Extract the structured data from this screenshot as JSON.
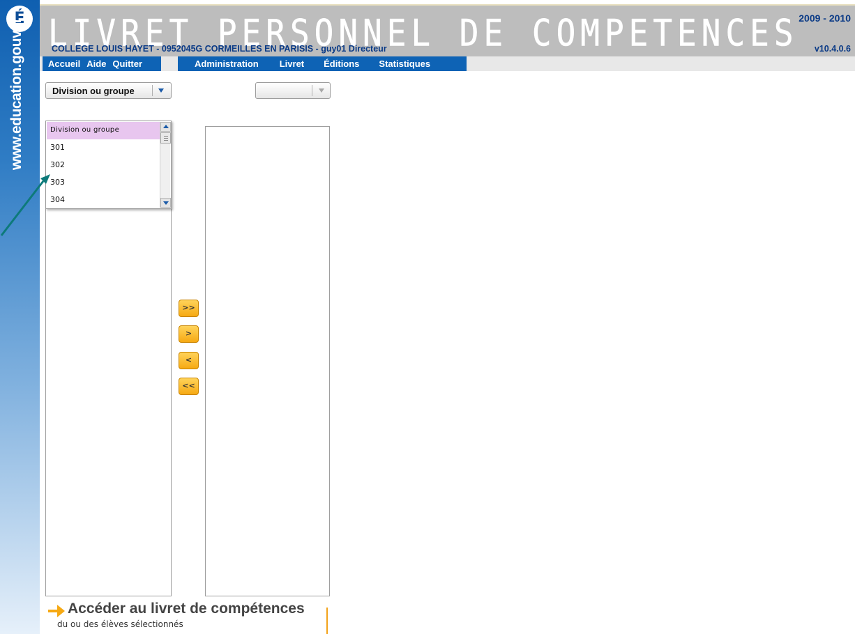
{
  "sidebar": {
    "logo_text": "É",
    "url": "www.education.gouv.fr"
  },
  "header": {
    "app_title": "LIVRET PERSONNEL DE COMPETENCES",
    "school_line": "COLLEGE LOUIS HAYET  - 0952045G CORMEILLES EN PARISIS - guy01 Directeur",
    "year": "2009 - 2010",
    "version": "v10.4.0.6"
  },
  "menu": {
    "left": [
      "Accueil",
      "Aide",
      "Quitter"
    ],
    "right": [
      "Administration",
      "Livret",
      "Éditions",
      "Statistiques"
    ]
  },
  "division_select": {
    "value": "Division ou groupe",
    "options": [
      "Division ou groupe",
      "301",
      "302",
      "303",
      "304"
    ],
    "selected_index": 0
  },
  "second_select": {
    "value": ""
  },
  "transfer_buttons": [
    ">>",
    ">",
    "<",
    "<<"
  ],
  "access_link": {
    "title": "Accéder au livret de compétences",
    "subtitle": "du ou des élèves sélectionnés"
  },
  "colors": {
    "menu_blue": "#0e63b5",
    "header_gray": "#bdbdbd",
    "text_navy": "#0a3a86",
    "button_orange": "#f6a913",
    "selected_option": "#e8c6ef",
    "annotation_arrow": "#0d7a7a"
  },
  "icons": {
    "logo": "marianne-e-logo-icon",
    "dropdown_arrow": "chevron-down-icon",
    "access_arrow": "arrow-right-icon"
  }
}
